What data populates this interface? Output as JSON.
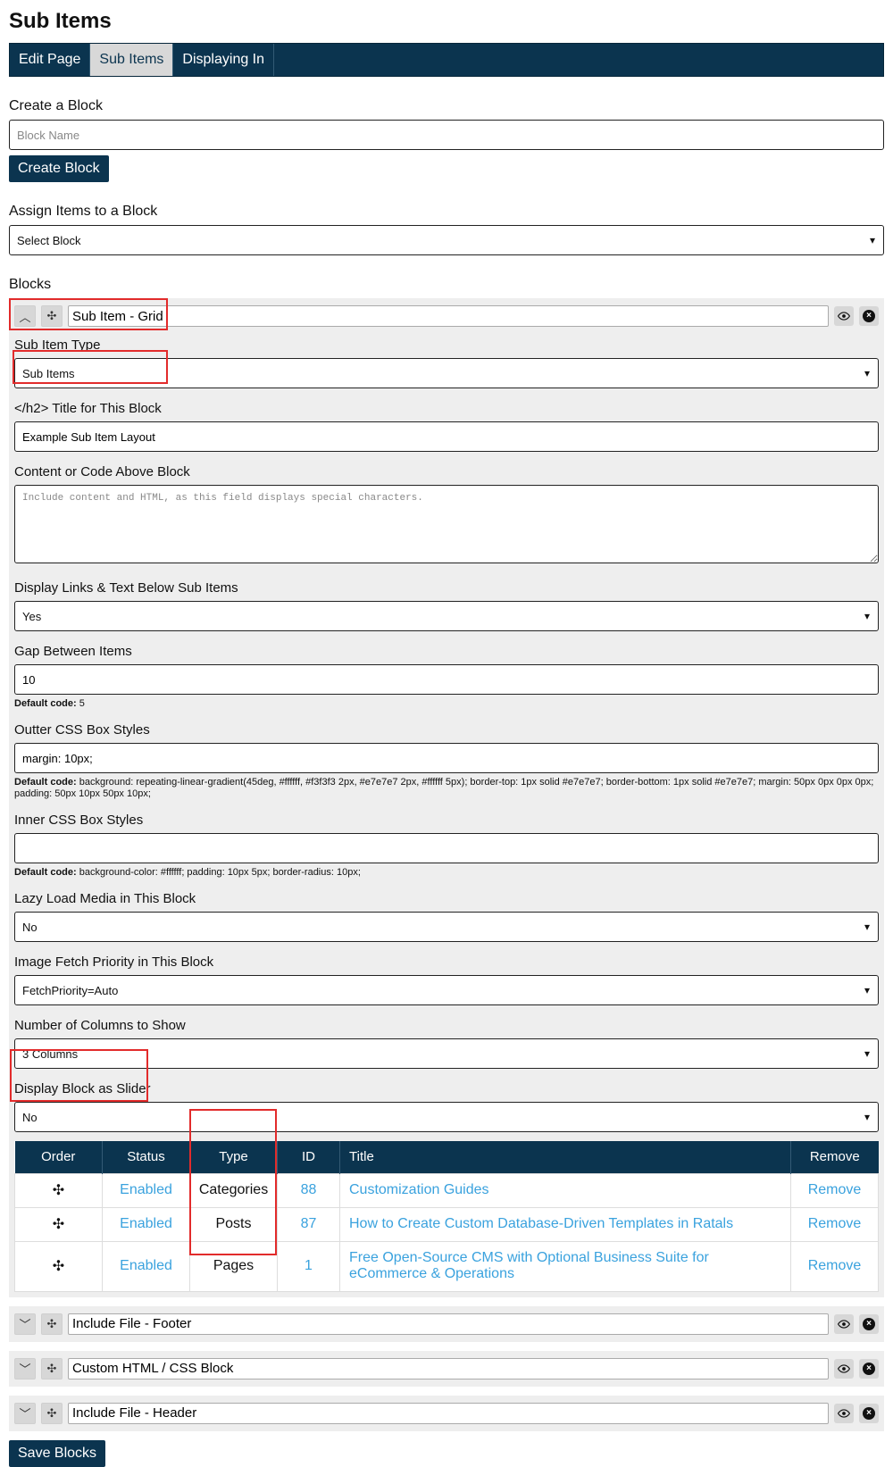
{
  "page": {
    "title": "Sub Items"
  },
  "tabs": [
    {
      "label": "Edit Page",
      "active": false
    },
    {
      "label": "Sub Items",
      "active": true
    },
    {
      "label": "Displaying In",
      "active": false
    }
  ],
  "create_block": {
    "label": "Create a Block",
    "input_placeholder": "Block Name",
    "button_label": "Create Block"
  },
  "assign_block": {
    "label": "Assign Items to a Block",
    "selected": "Select Block"
  },
  "blocks_section": {
    "label": "Blocks"
  },
  "block_main": {
    "name": "Sub Item - Grid",
    "fields": {
      "sub_item_type": {
        "label": "Sub Item Type",
        "value": "Sub Items"
      },
      "title_for_block": {
        "label": "</h2> Title for This Block",
        "value": "Example Sub Item Layout"
      },
      "content_above": {
        "label": "Content or Code Above Block",
        "placeholder": "Include content and HTML, as this field displays special characters."
      },
      "display_links": {
        "label": "Display Links & Text Below Sub Items",
        "value": "Yes"
      },
      "gap": {
        "label": "Gap Between Items",
        "value": "10",
        "hint_bold": "Default code:",
        "hint_text": "5"
      },
      "outer_css": {
        "label": "Outter CSS Box Styles",
        "value": "margin: 10px;",
        "hint_bold": "Default code:",
        "hint_text": "background: repeating-linear-gradient(45deg, #ffffff, #f3f3f3 2px, #e7e7e7 2px, #ffffff 5px); border-top: 1px solid #e7e7e7; border-bottom: 1px solid #e7e7e7; margin: 50px 0px 0px 0px; padding: 50px 10px 50px 10px;"
      },
      "inner_css": {
        "label": "Inner CSS Box Styles",
        "value": "",
        "hint_bold": "Default code:",
        "hint_text": "background-color: #ffffff; padding: 10px 5px; border-radius: 10px;"
      },
      "lazy_load": {
        "label": "Lazy Load Media in This Block",
        "value": "No"
      },
      "fetch_priority": {
        "label": "Image Fetch Priority in This Block",
        "value": "FetchPriority=Auto"
      },
      "columns": {
        "label": "Number of Columns to Show",
        "value": "3 Columns"
      },
      "slider": {
        "label": "Display Block as Slider",
        "value": "No"
      }
    },
    "table": {
      "headers": [
        "Order",
        "Status",
        "Type",
        "ID",
        "Title",
        "Remove"
      ],
      "rows": [
        {
          "status": "Enabled",
          "type": "Categories",
          "id": "88",
          "title": "Customization Guides",
          "remove": "Remove"
        },
        {
          "status": "Enabled",
          "type": "Posts",
          "id": "87",
          "title": "How to Create Custom Database-Driven Templates in Ratals",
          "remove": "Remove"
        },
        {
          "status": "Enabled",
          "type": "Pages",
          "id": "1",
          "title": "Free Open-Source CMS with Optional Business Suite for eCommerce & Operations",
          "remove": "Remove"
        }
      ]
    }
  },
  "other_blocks": [
    {
      "name": "Include File - Footer"
    },
    {
      "name": "Custom HTML / CSS Block"
    },
    {
      "name": "Include File - Header"
    }
  ],
  "save_button": {
    "label": "Save Blocks"
  },
  "colors": {
    "navy": "#0b344f",
    "link": "#3aa2de",
    "highlight": "#e22b2b"
  }
}
